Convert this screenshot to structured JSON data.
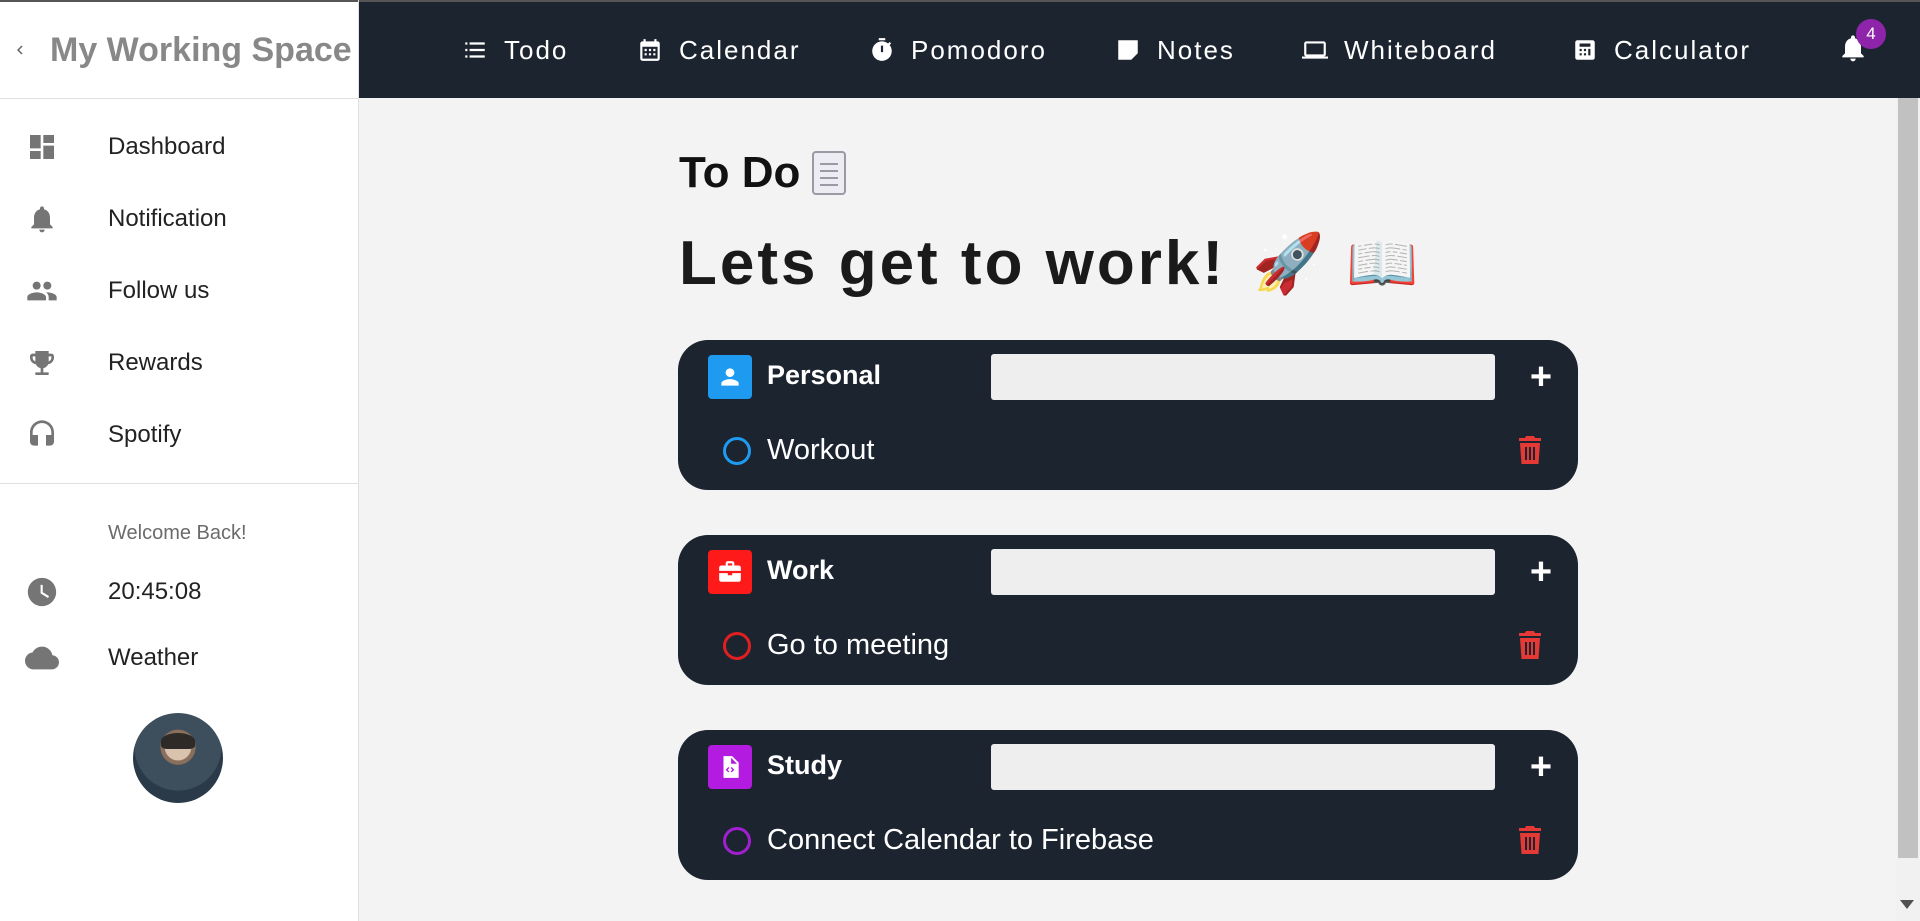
{
  "sidebar": {
    "title": "My Working Space",
    "items": [
      {
        "label": "Dashboard",
        "icon": "dashboard-icon"
      },
      {
        "label": "Notification",
        "icon": "bell-icon"
      },
      {
        "label": "Follow us",
        "icon": "people-icon"
      },
      {
        "label": "Rewards",
        "icon": "trophy-icon"
      },
      {
        "label": "Spotify",
        "icon": "headphones-icon"
      }
    ],
    "welcome": "Welcome Back!",
    "time": "20:45:08",
    "weather": "Weather"
  },
  "topnav": {
    "items": [
      {
        "label": "Todo",
        "icon": "list-icon"
      },
      {
        "label": "Calendar",
        "icon": "calendar-icon"
      },
      {
        "label": "Pomodoro",
        "icon": "stopwatch-icon"
      },
      {
        "label": "Notes",
        "icon": "note-icon"
      },
      {
        "label": "Whiteboard",
        "icon": "laptop-icon"
      },
      {
        "label": "Calculator",
        "icon": "calculator-icon"
      }
    ],
    "notification_count": "4"
  },
  "main": {
    "title": "To Do",
    "headline": "Lets get to work!",
    "headline_emoji": "🚀 📖",
    "categories": [
      {
        "name": "Personal",
        "color": "#1e9bf0",
        "icon": "user-icon",
        "input_value": "",
        "add_label": "+",
        "task": "Workout",
        "circle_color": "#1e9bf0"
      },
      {
        "name": "Work",
        "color": "#ff1a1a",
        "icon": "briefcase-icon",
        "input_value": "",
        "add_label": "+",
        "task": "Go to meeting",
        "circle_color": "#e02020"
      },
      {
        "name": "Study",
        "color": "#b31be0",
        "icon": "code-file-icon",
        "input_value": "",
        "add_label": "+",
        "task": "Connect Calendar to Firebase",
        "circle_color": "#a020d0"
      }
    ]
  },
  "colors": {
    "topbar_bg": "#1c2430",
    "card_bg": "#1c2430",
    "delete": "#e53935",
    "badge": "#8e24aa"
  }
}
